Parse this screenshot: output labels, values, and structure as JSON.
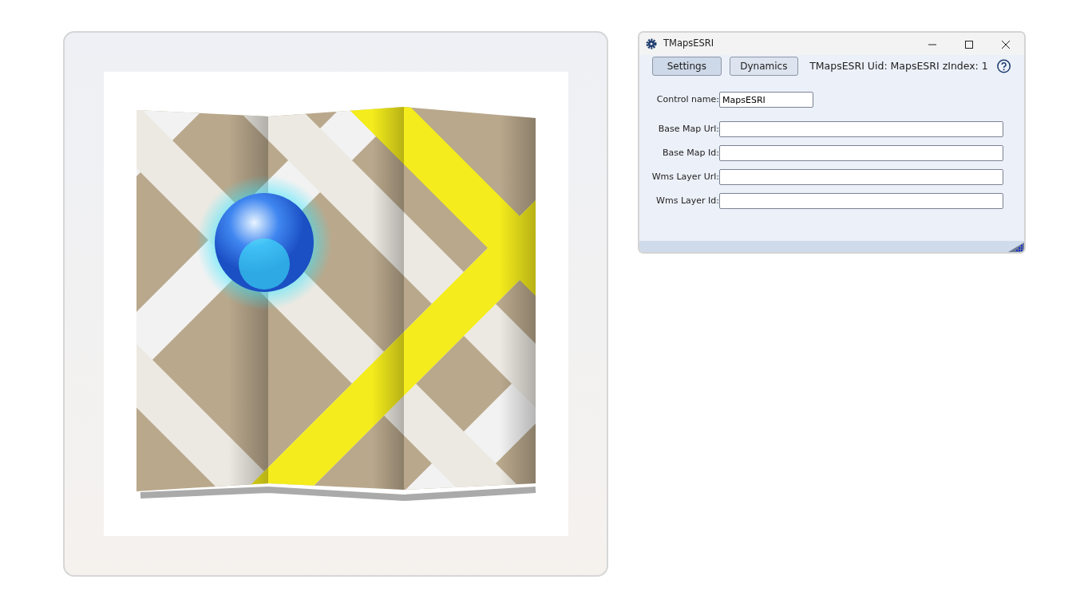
{
  "window": {
    "title": "TMapsESRI"
  },
  "tabs": [
    {
      "label": "Settings",
      "selected": true
    },
    {
      "label": "Dynamics",
      "selected": false
    }
  ],
  "header_info": "TMapsESRI Uid: MapsESRI zIndex: 1",
  "control_name": {
    "label": "Control name:",
    "value": "MapsESRI"
  },
  "fields": [
    {
      "label": "Base Map Url:"
    },
    {
      "label": "Base Map Id:"
    },
    {
      "label": "Wms Layer Url:"
    },
    {
      "label": "Wms Layer Id:"
    }
  ]
}
